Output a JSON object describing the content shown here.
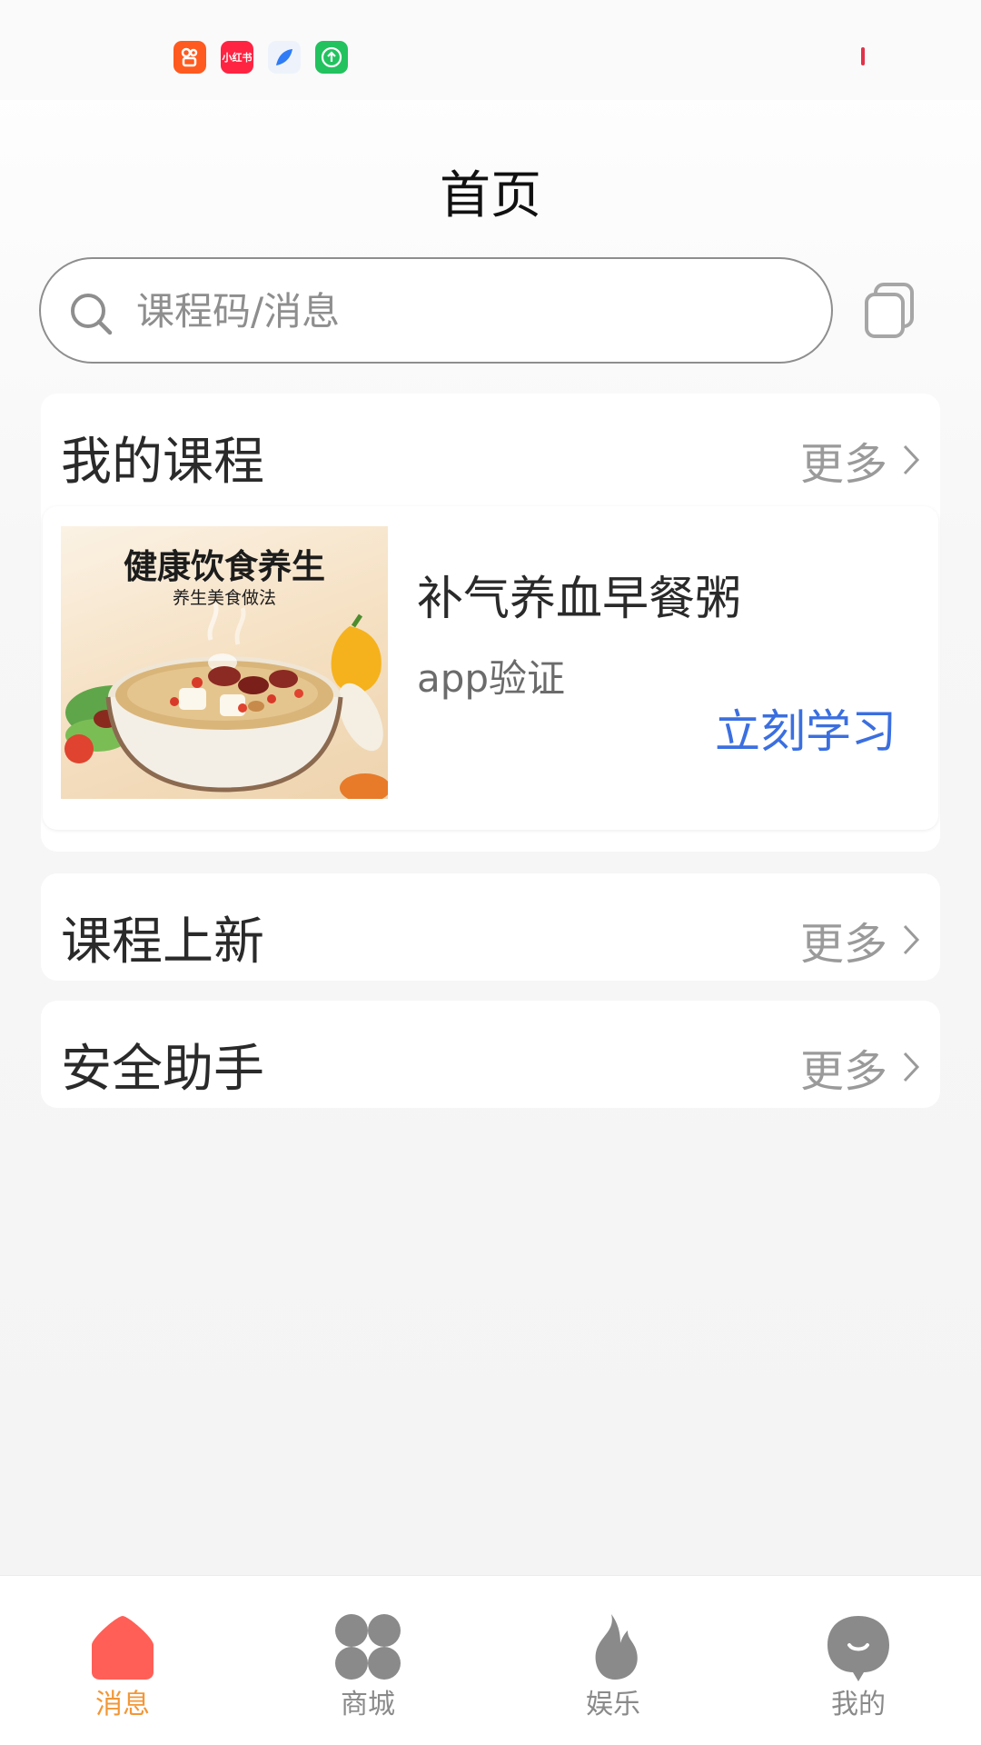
{
  "status_bar": {
    "app_icons": [
      "kuaishou-icon",
      "xiaohongshu-icon",
      "feather-app-icon",
      "upload-app-icon"
    ],
    "xiaohongshu_text": "小红书"
  },
  "header": {
    "title": "首页"
  },
  "search": {
    "placeholder": "课程码/消息",
    "value": ""
  },
  "my_courses": {
    "title": "我的课程",
    "more_label": "更多",
    "course": {
      "thumbnail_title": "健康饮食养生",
      "thumbnail_subtitle": "养生美食做法",
      "name": "补气养血早餐粥",
      "description": "app验证",
      "action_label": "立刻学习"
    }
  },
  "new_courses": {
    "title": "课程上新",
    "more_label": "更多"
  },
  "safety_assistant": {
    "title": "安全助手",
    "more_label": "更多"
  },
  "bottom_nav": {
    "items": [
      {
        "label": "消息",
        "icon": "home-icon",
        "active": true
      },
      {
        "label": "商城",
        "icon": "clover-icon",
        "active": false
      },
      {
        "label": "娱乐",
        "icon": "flame-icon",
        "active": false
      },
      {
        "label": "我的",
        "icon": "profile-icon",
        "active": false
      }
    ]
  },
  "colors": {
    "accent_active": "#f29738",
    "home_icon": "#ff5f57",
    "link_blue": "#3b6fe0",
    "inactive_gray": "#8a8a8a"
  }
}
